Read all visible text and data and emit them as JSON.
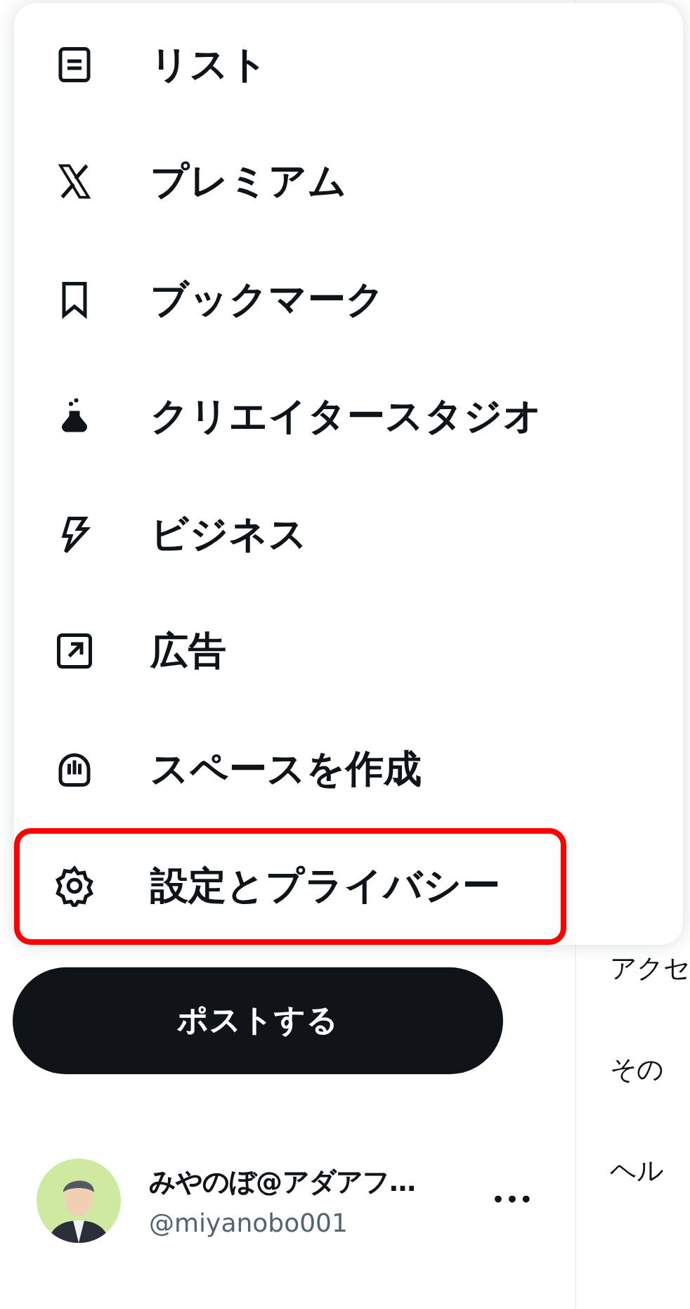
{
  "menu": {
    "items": [
      {
        "label": "リスト",
        "highlighted": false
      },
      {
        "label": "プレミアム",
        "highlighted": false
      },
      {
        "label": "ブックマーク",
        "highlighted": false
      },
      {
        "label": "クリエイタースタジオ",
        "highlighted": false
      },
      {
        "label": "ビジネス",
        "highlighted": false
      },
      {
        "label": "広告",
        "highlighted": false
      },
      {
        "label": "スペースを作成",
        "highlighted": false
      },
      {
        "label": "設定とプライバシー",
        "highlighted": true
      }
    ]
  },
  "post_button": "ポストする",
  "account": {
    "name": "みやのぼ@アダアフ…",
    "handle": "@miyanobo001",
    "more": "•••"
  },
  "side_links": [
    "アクセ",
    "その",
    "ヘル"
  ]
}
